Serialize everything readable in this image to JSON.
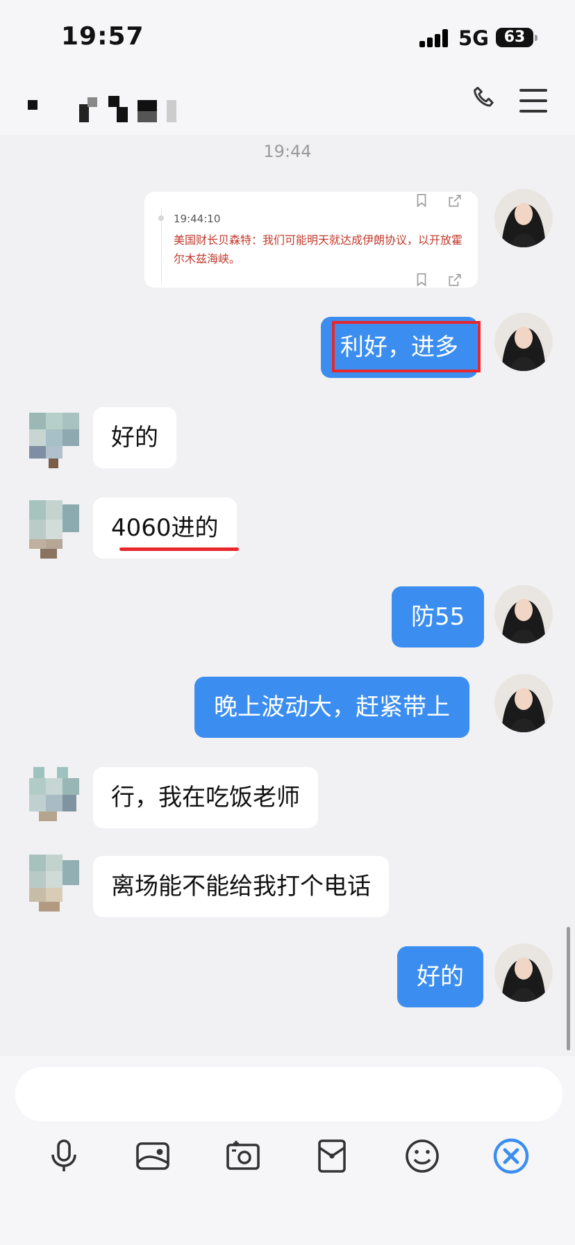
{
  "status_bar": {
    "time": "19:57",
    "network": "5G",
    "battery": "63"
  },
  "chat": {
    "last_time": "19:44"
  },
  "news_card": {
    "time": "19:44:10",
    "text": "美国财长贝森特：我们可能明天就达成伊朗协议，以开放霍尔木兹海峡。"
  },
  "messages": [
    {
      "from": "me",
      "text": "利好，进多"
    },
    {
      "from": "other",
      "text": "好的"
    },
    {
      "from": "other",
      "text": "4060进的"
    },
    {
      "from": "me",
      "text": "防55"
    },
    {
      "from": "me",
      "text": "晚上波动大，赶紧带上"
    },
    {
      "from": "other",
      "text": "行，我在吃饭老师"
    },
    {
      "from": "other",
      "text": "离场能不能给我打个电话"
    },
    {
      "from": "me",
      "text": "好的"
    }
  ],
  "colors": {
    "my_bubble": "#3b8ef0",
    "highlight": "#e8272c",
    "background": "#f1f1f3"
  },
  "icons": [
    "phone-icon",
    "menu-icon",
    "bookmark-icon",
    "share-icon",
    "microphone-icon",
    "image-icon",
    "camera-icon",
    "red-packet-icon",
    "emoji-icon",
    "close-icon"
  ]
}
